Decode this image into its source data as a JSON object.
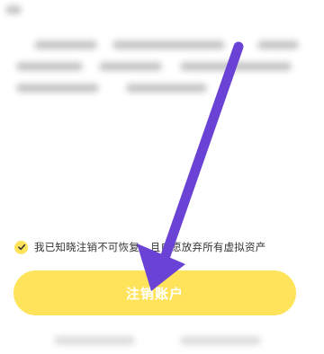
{
  "agreement": {
    "checked": true,
    "text": "我已知晓注销不可恢复，且自愿放弃所有虚拟资产"
  },
  "primary_button": {
    "label": "注销账户"
  },
  "colors": {
    "accent_yellow": "#ffe35a",
    "arrow_purple": "#6a43d6",
    "text_dark": "#333333"
  },
  "icons": {
    "checkbox": "check-icon",
    "annotation": "arrow-annotation"
  }
}
